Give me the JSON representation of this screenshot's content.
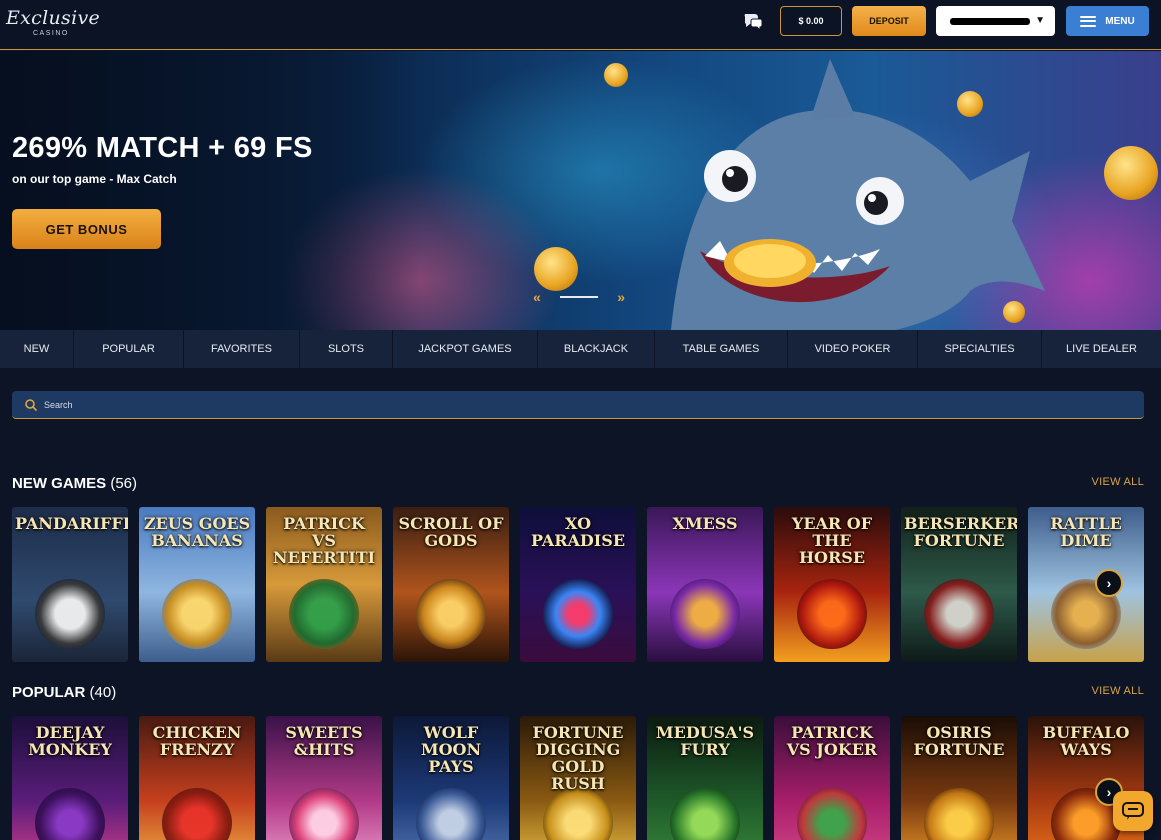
{
  "header": {
    "logo_script": "Exclusive",
    "logo_sub": "CASINO",
    "balance": "$ 0.00",
    "deposit_label": "DEPOSIT",
    "menu_label": "MENU"
  },
  "hero": {
    "title": "269% MATCH + 69 FS",
    "subtitle": "on our top game - Max Catch",
    "button_label": "GET BONUS",
    "prev_arrow": "«",
    "next_arrow": "»"
  },
  "categories": [
    "NEW",
    "POPULAR",
    "FAVORITES",
    "SLOTS",
    "JACKPOT GAMES",
    "BLACKJACK",
    "TABLE GAMES",
    "VIDEO POKER",
    "SPECIALTIES",
    "LIVE DEALER"
  ],
  "search": {
    "placeholder": "Search"
  },
  "new_games": {
    "title": "NEW GAMES",
    "count": "(56)",
    "view_all": "VIEW ALL",
    "games": [
      {
        "name": "PANDARIFFIC"
      },
      {
        "name": "ZEUS GOES BANANAS"
      },
      {
        "name": "PATRICK VS NEFERTITI"
      },
      {
        "name": "SCROLL OF GODS"
      },
      {
        "name": "XO PARADISE"
      },
      {
        "name": "XMESS"
      },
      {
        "name": "YEAR OF THE HORSE"
      },
      {
        "name": "BERSERKERS FORTUNE"
      },
      {
        "name": "RATTLE DIME"
      }
    ]
  },
  "popular": {
    "title": "POPULAR",
    "count": "(40)",
    "view_all": "VIEW ALL",
    "games": [
      {
        "name": "DEEJAY MONKEY"
      },
      {
        "name": "CHICKEN FRENZY"
      },
      {
        "name": "SWEETS &HITS"
      },
      {
        "name": "WOLF MOON PAYS"
      },
      {
        "name": "FORTUNE DIGGING GOLD RUSH"
      },
      {
        "name": "MEDUSA'S FURY"
      },
      {
        "name": "PATRICK VS JOKER"
      },
      {
        "name": "OSIRIS FORTUNE"
      },
      {
        "name": "BUFFALO WAYS"
      }
    ]
  },
  "theme": {
    "accent": "#e0891a",
    "menu_blue": "#3b7fd4",
    "gold_text": "#d8a444"
  }
}
